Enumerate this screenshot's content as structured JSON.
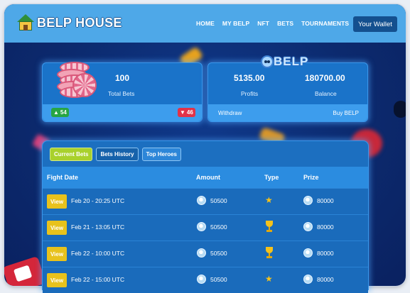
{
  "header": {
    "logo_text": "BELP HOUSE",
    "nav": [
      "HOME",
      "MY BELP",
      "NFT",
      "BETS",
      "TOURNAMENTS"
    ],
    "wallet_label": "Your Wallet"
  },
  "stats": {
    "total_bets_value": "100",
    "total_bets_label": "Total Bets",
    "likes": "54",
    "dislikes": "46"
  },
  "balance": {
    "brand": "BELP",
    "profits_value": "5135.00",
    "profits_label": "Profits",
    "balance_value": "180700.00",
    "balance_label": "Balance",
    "withdraw_label": "Withdraw",
    "buy_label": "Buy BELP"
  },
  "bets": {
    "tabs": [
      "Current Bets",
      "Bets History",
      "Top Heroes"
    ],
    "active_tab": "Current Bets",
    "columns": [
      "Fight Date",
      "Amount",
      "Type",
      "Prize"
    ],
    "view_label": "View",
    "rows": [
      {
        "date": "Feb 20 - 20:25 UTC",
        "amount": "50500",
        "type": "star-icon",
        "prize": "80000"
      },
      {
        "date": "Feb 21 - 13:05 UTC",
        "amount": "50500",
        "type": "trophy-icon",
        "prize": "80000"
      },
      {
        "date": "Feb 22 - 10:00 UTC",
        "amount": "50500",
        "type": "trophy-icon",
        "prize": "80000"
      },
      {
        "date": "Feb 22 - 15:00 UTC",
        "amount": "50500",
        "type": "star-icon",
        "prize": "80000"
      }
    ]
  },
  "colors": {
    "header_bg": "#4ea8e8",
    "panel_bg": "#1a73c9",
    "accent_green": "#a9d12c",
    "view_yellow": "#e8c21c",
    "like_green": "#27a544",
    "dislike_red": "#e23248"
  }
}
